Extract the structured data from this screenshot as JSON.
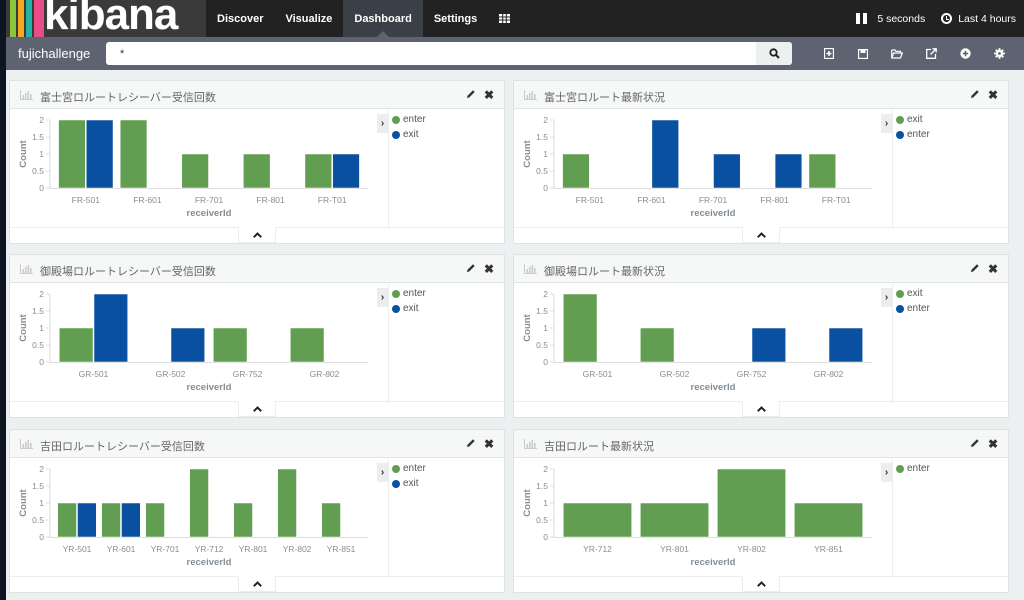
{
  "app": {
    "logo_text": "kibana",
    "logo_colors": [
      "#8cc63f",
      "#f0ab1f",
      "#22b3a6",
      "#ea4c89"
    ],
    "nav_tabs": [
      {
        "label": "Discover",
        "active": false
      },
      {
        "label": "Visualize",
        "active": false
      },
      {
        "label": "Dashboard",
        "active": true
      },
      {
        "label": "Settings",
        "active": false
      }
    ],
    "apps_icon": "grid-icon",
    "refresh_interval": "5 seconds",
    "time_range": "Last 4 hours"
  },
  "querybar": {
    "dashboard_name": "fujichallenge",
    "query": "*",
    "search_icon": "search-icon",
    "tools": [
      {
        "name": "new-dashboard",
        "icon": "new-file-icon"
      },
      {
        "name": "save-dashboard",
        "icon": "save-icon"
      },
      {
        "name": "load-dashboard",
        "icon": "folder-open-icon"
      },
      {
        "name": "share-dashboard",
        "icon": "share-icon"
      },
      {
        "name": "add-visualization",
        "icon": "plus-circle-icon"
      },
      {
        "name": "options",
        "icon": "gear-icon"
      }
    ]
  },
  "colors": {
    "green": "#629e51",
    "blue": "#0a50a1",
    "axis": "#ddd",
    "tick_text": "#848e96"
  },
  "chart_data": [
    {
      "title": "富士宮ロルートレシーバー受信回数",
      "type": "bar",
      "xlabel": "receiverId",
      "ylabel": "Count",
      "ylim": [
        0,
        2
      ],
      "yticks": [
        "0",
        "0.5",
        "1",
        "1.5",
        "2"
      ],
      "categories": [
        "FR-501",
        "FR-601",
        "FR-701",
        "FR-801",
        "FR-T01"
      ],
      "series": [
        {
          "name": "enter",
          "color": "#629e51",
          "values": [
            2,
            2,
            1,
            1,
            1
          ]
        },
        {
          "name": "exit",
          "color": "#0a50a1",
          "values": [
            2,
            0,
            0,
            0,
            1
          ]
        }
      ]
    },
    {
      "title": "富士宮ロルート最新状況",
      "type": "bar",
      "xlabel": "receiverId",
      "ylabel": "Count",
      "ylim": [
        0,
        2
      ],
      "yticks": [
        "0",
        "0.5",
        "1",
        "1.5",
        "2"
      ],
      "categories": [
        "FR-501",
        "FR-601",
        "FR-701",
        "FR-801",
        "FR-T01"
      ],
      "series": [
        {
          "name": "exit",
          "color": "#629e51",
          "values": [
            1,
            0,
            0,
            0,
            1
          ]
        },
        {
          "name": "enter",
          "color": "#0a50a1",
          "values": [
            0,
            2,
            1,
            1,
            0
          ]
        }
      ]
    },
    {
      "title": "御殿場ロルートレシーバー受信回数",
      "type": "bar",
      "xlabel": "receiverId",
      "ylabel": "Count",
      "ylim": [
        0,
        2
      ],
      "yticks": [
        "0",
        "0.5",
        "1",
        "1.5",
        "2"
      ],
      "categories": [
        "GR-501",
        "GR-502",
        "GR-752",
        "GR-802"
      ],
      "series": [
        {
          "name": "enter",
          "color": "#629e51",
          "values": [
            1,
            0,
            1,
            1
          ]
        },
        {
          "name": "exit",
          "color": "#0a50a1",
          "values": [
            2,
            1,
            0,
            0
          ]
        }
      ]
    },
    {
      "title": "御殿場ロルート最新状況",
      "type": "bar",
      "xlabel": "receiverId",
      "ylabel": "Count",
      "ylim": [
        0,
        2
      ],
      "yticks": [
        "0",
        "0.5",
        "1",
        "1.5",
        "2"
      ],
      "categories": [
        "GR-501",
        "GR-502",
        "GR-752",
        "GR-802"
      ],
      "series": [
        {
          "name": "exit",
          "color": "#629e51",
          "values": [
            2,
            1,
            0,
            0
          ]
        },
        {
          "name": "enter",
          "color": "#0a50a1",
          "values": [
            0,
            0,
            1,
            1
          ]
        }
      ]
    },
    {
      "title": "吉田ロルートレシーバー受信回数",
      "type": "bar",
      "xlabel": "receiverId",
      "ylabel": "Count",
      "ylim": [
        0,
        2
      ],
      "yticks": [
        "0",
        "0.5",
        "1",
        "1.5",
        "2"
      ],
      "categories": [
        "YR-501",
        "YR-601",
        "YR-701",
        "YR-712",
        "YR-801",
        "YR-802",
        "YR-851"
      ],
      "series": [
        {
          "name": "enter",
          "color": "#629e51",
          "values": [
            1,
            1,
            1,
            2,
            1,
            2,
            1
          ]
        },
        {
          "name": "exit",
          "color": "#0a50a1",
          "values": [
            1,
            1,
            0,
            0,
            0,
            0,
            0
          ]
        }
      ]
    },
    {
      "title": "吉田ロルート最新状況",
      "type": "bar",
      "xlabel": "receiverId",
      "ylabel": "Count",
      "ylim": [
        0,
        2
      ],
      "yticks": [
        "0",
        "0.5",
        "1",
        "1.5",
        "2"
      ],
      "categories": [
        "YR-712",
        "YR-801",
        "YR-802",
        "YR-851"
      ],
      "series": [
        {
          "name": "enter",
          "color": "#629e51",
          "values": [
            1,
            1,
            2,
            1
          ]
        }
      ]
    }
  ]
}
